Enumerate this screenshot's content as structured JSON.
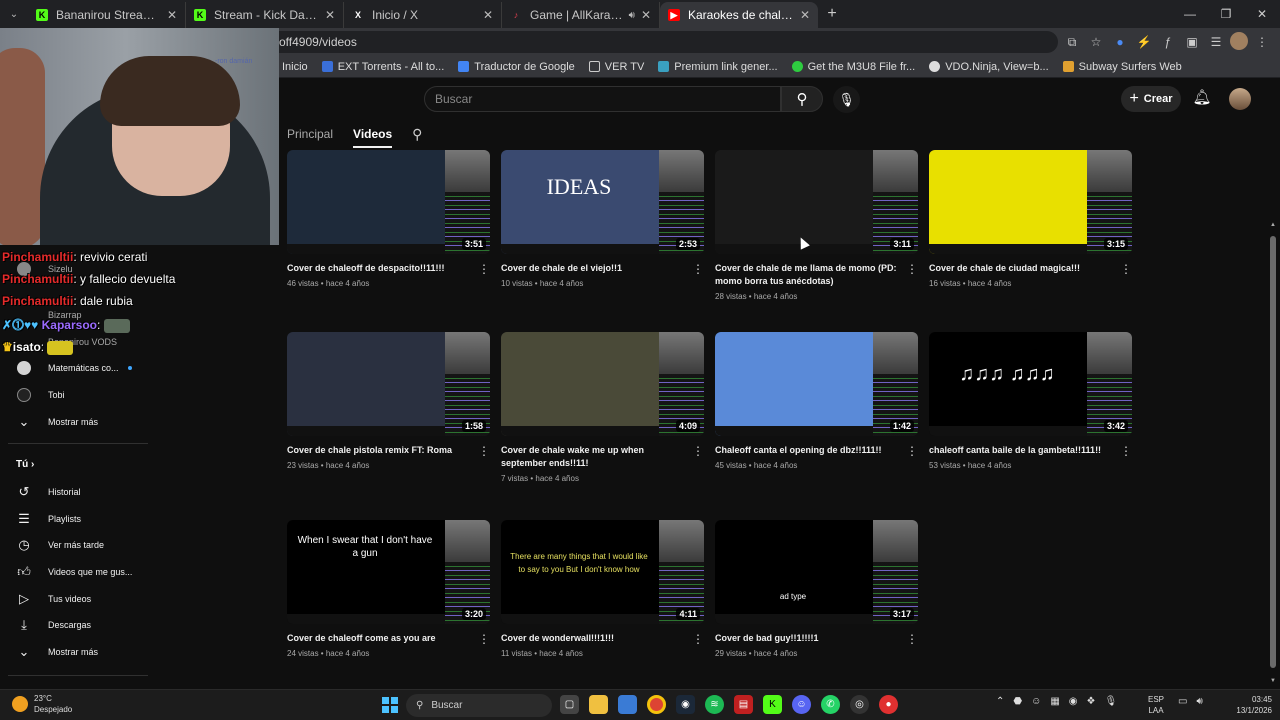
{
  "browser": {
    "tabs": [
      {
        "title": "Bananirou Stream - Watch Live",
        "favicon_color": "#53fc18",
        "favicon": "K"
      },
      {
        "title": "Stream - Kick Dashboard",
        "favicon_color": "#53fc18",
        "favicon": "K"
      },
      {
        "title": "Inicio / X",
        "favicon_color": "#ffffff",
        "favicon": "X"
      },
      {
        "title": "Game | AllKaraoke.Party - F",
        "favicon_color": "#e04050",
        "favicon": "♪"
      },
      {
        "title": "Karaokes de chaleoff - YouTube",
        "favicon_color": "#ff0000",
        "favicon": "▶"
      }
    ],
    "url": "youtube.com/@karaokesdechaleoff4909/videos",
    "bookmarks": [
      {
        "label": "Inicio",
        "color": "#35363a"
      },
      {
        "label": "EXT Torrents - All to...",
        "color": "#3a6fd8"
      },
      {
        "label": "Traductor de Google",
        "color": "#4285f4"
      },
      {
        "label": "VER TV",
        "color": "#35363a"
      },
      {
        "label": "Premium link gener...",
        "color": "#3aa0c0"
      },
      {
        "label": "Get the M3U8 File fr...",
        "color": "#2ecc40"
      },
      {
        "label": "VDO.Ninja, View=b...",
        "color": "#dddddd"
      },
      {
        "label": "Subway Surfers Web",
        "color": "#e0a030"
      }
    ]
  },
  "youtube": {
    "search_placeholder": "Buscar",
    "create_label": "Crear",
    "channel_tabs": [
      "Principal",
      "Videos"
    ],
    "videos": [
      {
        "title": "Cover de chaleoff de despacito!!11!!!",
        "meta": "46 vistas • hace 4 años",
        "duration": "3:51",
        "screen_color": "#1e2a3a",
        "overlay": ""
      },
      {
        "title": "Cover de chale de el viejo!!1",
        "meta": "10 vistas • hace 4 años",
        "duration": "2:53",
        "screen_color": "#3a4a70",
        "overlay": "IDEAS"
      },
      {
        "title": "Cover de chale de me llama de momo (PD: momo borra tus anécdotas)",
        "meta": "28 vistas • hace 4 años",
        "duration": "3:11",
        "screen_color": "#1a1a1a",
        "overlay": ""
      },
      {
        "title": "Cover de chale de ciudad magica!!!",
        "meta": "16 vistas • hace 4 años",
        "duration": "3:15",
        "screen_color": "#e8e000",
        "overlay": ""
      },
      {
        "title": "Cover de chale pistola remix FT: Roma",
        "meta": "23 vistas • hace 4 años",
        "duration": "1:58",
        "screen_color": "#2a3040",
        "overlay": ""
      },
      {
        "title": "Cover de chale wake me up when september ends!!11!",
        "meta": "7 vistas • hace 4 años",
        "duration": "4:09",
        "screen_color": "#4a4a38",
        "overlay": ""
      },
      {
        "title": "Chaleoff canta el opening de dbz!!111!!",
        "meta": "45 vistas • hace 4 años",
        "duration": "1:42",
        "screen_color": "#5a8ad8",
        "overlay": ""
      },
      {
        "title": "chaleoff canta baile de la gambeta!!111!!",
        "meta": "53 vistas • hace 4 años",
        "duration": "3:42",
        "screen_color": "#000000",
        "overlay": "♫♫♫ ♫♫♫"
      },
      {
        "title": "Cover de chaleoff come as you are",
        "meta": "24 vistas • hace 4 años",
        "duration": "3:20",
        "screen_color": "#000000",
        "overlay": "When I swear that I don't have a gun"
      },
      {
        "title": "Cover de wonderwall!!!1!!!",
        "meta": "11 vistas • hace 4 años",
        "duration": "4:11",
        "screen_color": "#000000",
        "overlay": "There are many things that I would like to say to you But I don't know how"
      },
      {
        "title": "Cover de bad guy!!1!!!!1",
        "meta": "29 vistas • hace 4 años",
        "duration": "3:17",
        "screen_color": "#000000",
        "overlay": "ad type"
      }
    ]
  },
  "sidebar": {
    "subs": [
      {
        "label": "Sizelu"
      },
      {
        "label": "Bizarrap"
      },
      {
        "label": "Bananirou VODS"
      },
      {
        "label": "Matemáticas co..."
      },
      {
        "label": "Tobi"
      }
    ],
    "show_more_1": "Mostrar más",
    "you_section": "Tú",
    "you_items": [
      {
        "label": "Historial",
        "icon": "history-icon"
      },
      {
        "label": "Playlists",
        "icon": "playlist-icon"
      },
      {
        "label": "Ver más tarde",
        "icon": "watch-later-icon"
      },
      {
        "label": "Videos que me gus...",
        "icon": "like-icon"
      },
      {
        "label": "Tus videos",
        "icon": "your-videos-icon"
      },
      {
        "label": "Descargas",
        "icon": "download-icon"
      }
    ],
    "show_more_2": "Mostrar más"
  },
  "stream_chat": [
    {
      "user": "Pinchamultii",
      "msg": ": revivio cerati"
    },
    {
      "user": "Pinchamultii",
      "msg": ": y fallecio devuelta"
    },
    {
      "user": "Pinchamultii",
      "msg": ": dale rubia"
    },
    {
      "user": "Kaparsoo",
      "msg": ":"
    },
    {
      "user": "isato",
      "msg": ":"
    }
  ],
  "webcam": {
    "shelf_text": "-ron damián"
  },
  "taskbar": {
    "temperature": "23°C",
    "weather": "Despejado",
    "search_label": "Buscar",
    "lang_line1": "ESP",
    "lang_line2": "LAA",
    "time": "03:45",
    "date": "13/1/2026"
  }
}
